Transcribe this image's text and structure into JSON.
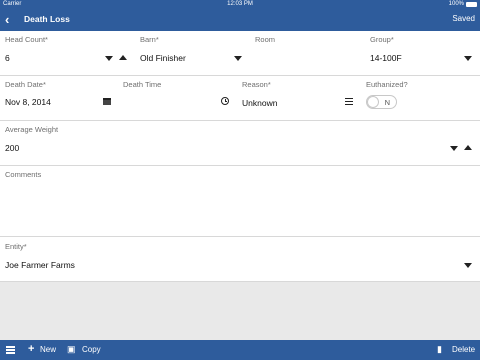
{
  "status_bar": {
    "carrier": "Carrier",
    "time": "12:03 PM",
    "battery": "100%"
  },
  "nav": {
    "back_icon": "chevron-left-icon",
    "title": "Death Loss",
    "status": "Saved"
  },
  "form": {
    "head_count": {
      "label": "Head Count*",
      "value": "6"
    },
    "barn": {
      "label": "Barn*",
      "value": "Old Finisher"
    },
    "room": {
      "label": "Room",
      "value": ""
    },
    "group": {
      "label": "Group*",
      "value": "14-100F"
    },
    "death_date": {
      "label": "Death Date*",
      "value": "Nov 8, 2014"
    },
    "death_time": {
      "label": "Death Time",
      "value": ""
    },
    "reason": {
      "label": "Reason*",
      "value": "Unknown"
    },
    "euthanized": {
      "label": "Euthanized?",
      "value": "N",
      "on": false
    },
    "average_weight": {
      "label": "Average Weight",
      "value": "200"
    },
    "comments": {
      "label": "Comments",
      "value": ""
    },
    "entity": {
      "label": "Entity*",
      "value": "Joe Farmer Farms"
    }
  },
  "toolbar": {
    "new_label": "New",
    "copy_label": "Copy",
    "delete_label": "Delete"
  },
  "colors": {
    "brand": "#2e5c9c",
    "background": "#ffffff",
    "divider": "#d8d8d8"
  }
}
